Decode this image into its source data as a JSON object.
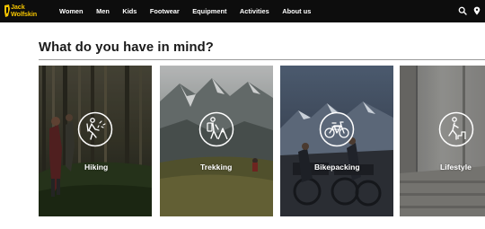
{
  "brand": {
    "logo_line1": "Jack",
    "logo_line2": "Wolfskin",
    "accent": "#f3c300"
  },
  "nav": {
    "items": [
      {
        "label": "Women"
      },
      {
        "label": "Men"
      },
      {
        "label": "Kids"
      },
      {
        "label": "Footwear"
      },
      {
        "label": "Equipment"
      },
      {
        "label": "Activities"
      },
      {
        "label": "About us"
      }
    ],
    "icons": [
      "search-icon",
      "location-pin-icon"
    ],
    "background": "#0d0d0d"
  },
  "main": {
    "heading": "What do you have in mind?",
    "cards": [
      {
        "label": "Hiking",
        "icon": "hiking-icon"
      },
      {
        "label": "Trekking",
        "icon": "trekking-icon"
      },
      {
        "label": "Bikepacking",
        "icon": "bikepacking-icon"
      },
      {
        "label": "Lifestyle",
        "icon": "lifestyle-icon"
      }
    ]
  }
}
